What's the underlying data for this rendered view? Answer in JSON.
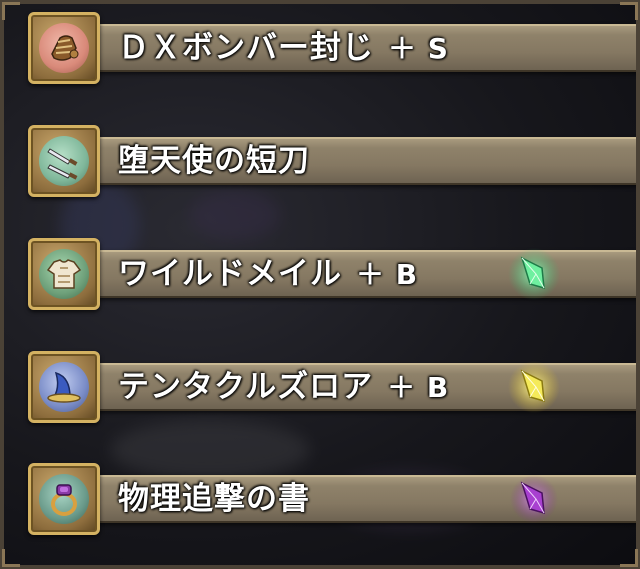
{
  "items": [
    {
      "name": "ＤＸボンバー封じ",
      "grade": "＋ S",
      "icon": "gauntlet-icon",
      "icon_bg": "#d98a7a",
      "crystal": null
    },
    {
      "name": "堕天使の短刀",
      "grade": "",
      "icon": "twin-dagger-icon",
      "icon_bg": "#7fb79a",
      "crystal": null
    },
    {
      "name": "ワイルドメイル",
      "grade": "＋ B",
      "icon": "armor-icon",
      "icon_bg": "#6ea07a",
      "crystal": "#5fe08f"
    },
    {
      "name": "テンタクルズロア",
      "grade": "＋ B",
      "icon": "wizard-hat-icon",
      "icon_bg": "#7a8cc7",
      "crystal": "#f0e64a"
    },
    {
      "name": "物理追撃の書",
      "grade": "",
      "icon": "ring-icon",
      "icon_bg": "#6a9a8a",
      "crystal": "#b04cd0"
    }
  ]
}
